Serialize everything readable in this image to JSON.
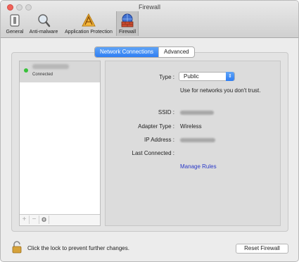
{
  "window": {
    "title": "Firewall"
  },
  "toolbar": {
    "items": [
      {
        "label": "General",
        "icon": "switch-icon"
      },
      {
        "label": "Anti-malware",
        "icon": "magnifier-icon"
      },
      {
        "label": "Application Protection",
        "icon": "app-icon"
      },
      {
        "label": "Firewall",
        "icon": "firewall-globe-icon",
        "selected": true
      }
    ]
  },
  "tabs": {
    "items": [
      "Network Connections",
      "Advanced"
    ],
    "selected": "Network Connections"
  },
  "network_list": {
    "rows": [
      {
        "status": "Connected",
        "status_color": "#39c13b"
      }
    ],
    "footer": {
      "add": "+",
      "remove": "−"
    }
  },
  "detail": {
    "type_label": "Type :",
    "type_value": "Public",
    "type_hint": "Use for networks you don't trust.",
    "ssid_label": "SSID :",
    "adapter_label": "Adapter Type :",
    "adapter_value": "Wireless",
    "ip_label": "IP Address :",
    "last_label": "Last Connected :",
    "manage_link": "Manage Rules"
  },
  "footer": {
    "lock_text": "Click the lock to prevent further changes.",
    "reset_button": "Reset Firewall"
  },
  "colors": {
    "accent": "#2f7ef3",
    "link": "#2a39c8"
  }
}
